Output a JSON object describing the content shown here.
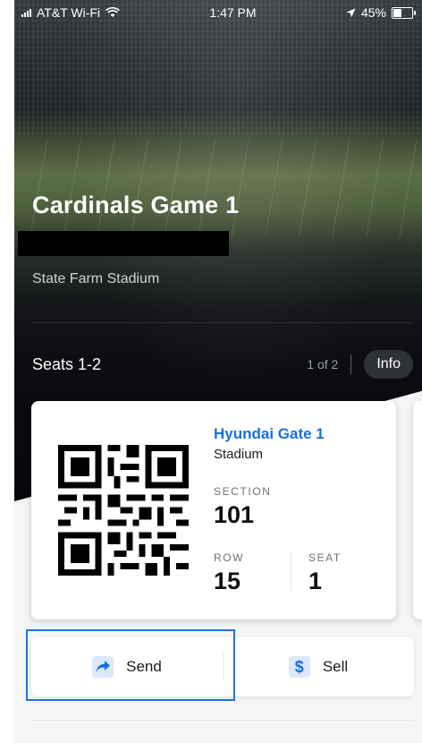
{
  "status_bar": {
    "carrier": "AT&T Wi-Fi",
    "time": "1:47 PM",
    "battery": "45%",
    "battery_level": 0.45
  },
  "event": {
    "title": "Cardinals Game 1",
    "venue": "State Farm Stadium"
  },
  "seats": {
    "label": "Seats 1-2",
    "counter": "1 of 2",
    "info_label": "Info"
  },
  "ticket": {
    "gate": "Hyundai Gate 1",
    "gate_sub": "Stadium",
    "section_label": "SECTION",
    "section_value": "101",
    "row_label": "ROW",
    "row_value": "15",
    "seat_label": "SEAT",
    "seat_value": "1"
  },
  "actions": {
    "send_label": "Send",
    "sell_label": "Sell"
  },
  "colors": {
    "accent": "#1a6fdc",
    "highlight": "#1a73e8"
  },
  "icons": {
    "send": "send-arrow-icon",
    "sell": "dollar-icon",
    "wifi": "wifi-icon",
    "location": "location-arrow-icon"
  }
}
